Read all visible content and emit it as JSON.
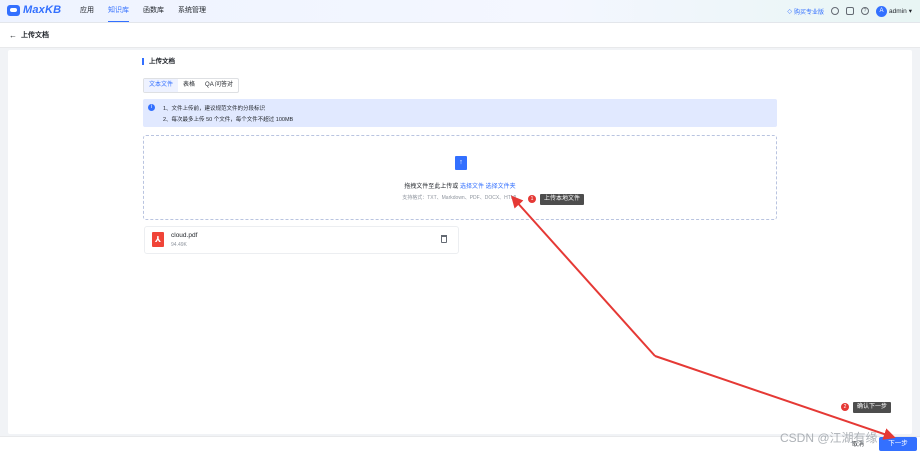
{
  "app": {
    "logo_text": "MaxKB",
    "accent": "#3370ff"
  },
  "nav": {
    "items": [
      "应用",
      "知识库",
      "函数库",
      "系统管理"
    ],
    "active_index": 1
  },
  "topbar": {
    "buy_label": "购买专业版",
    "user_avatar": "A",
    "user_name": "admin"
  },
  "page": {
    "back_title": "上传文档",
    "section_title": "上传文档"
  },
  "tabs": [
    "文本文件",
    "表格",
    "QA 问答对"
  ],
  "notice": {
    "line1": "1、文件上传前，建议规范文件的分段标识",
    "line2": "2、每次最多上传 50 个文件，每个文件不超过 100MB"
  },
  "dropzone": {
    "text": "拖拽文件至此上传或",
    "link_file": "选择文件",
    "link_folder": "选择文件夹",
    "formats": "支持格式：TXT、Markdown、PDF、DOCX、HTML"
  },
  "file": {
    "name": "cloud.pdf",
    "size": "94.49K"
  },
  "footer": {
    "cancel_label": "取消",
    "next_label": "下一步"
  },
  "annotations": {
    "badge1": "1",
    "callout1": "上传本地文件",
    "badge2": "2",
    "callout2": "确认下一步",
    "arrow_color": "#e53935"
  },
  "watermark": "CSDN @江湖有缘"
}
